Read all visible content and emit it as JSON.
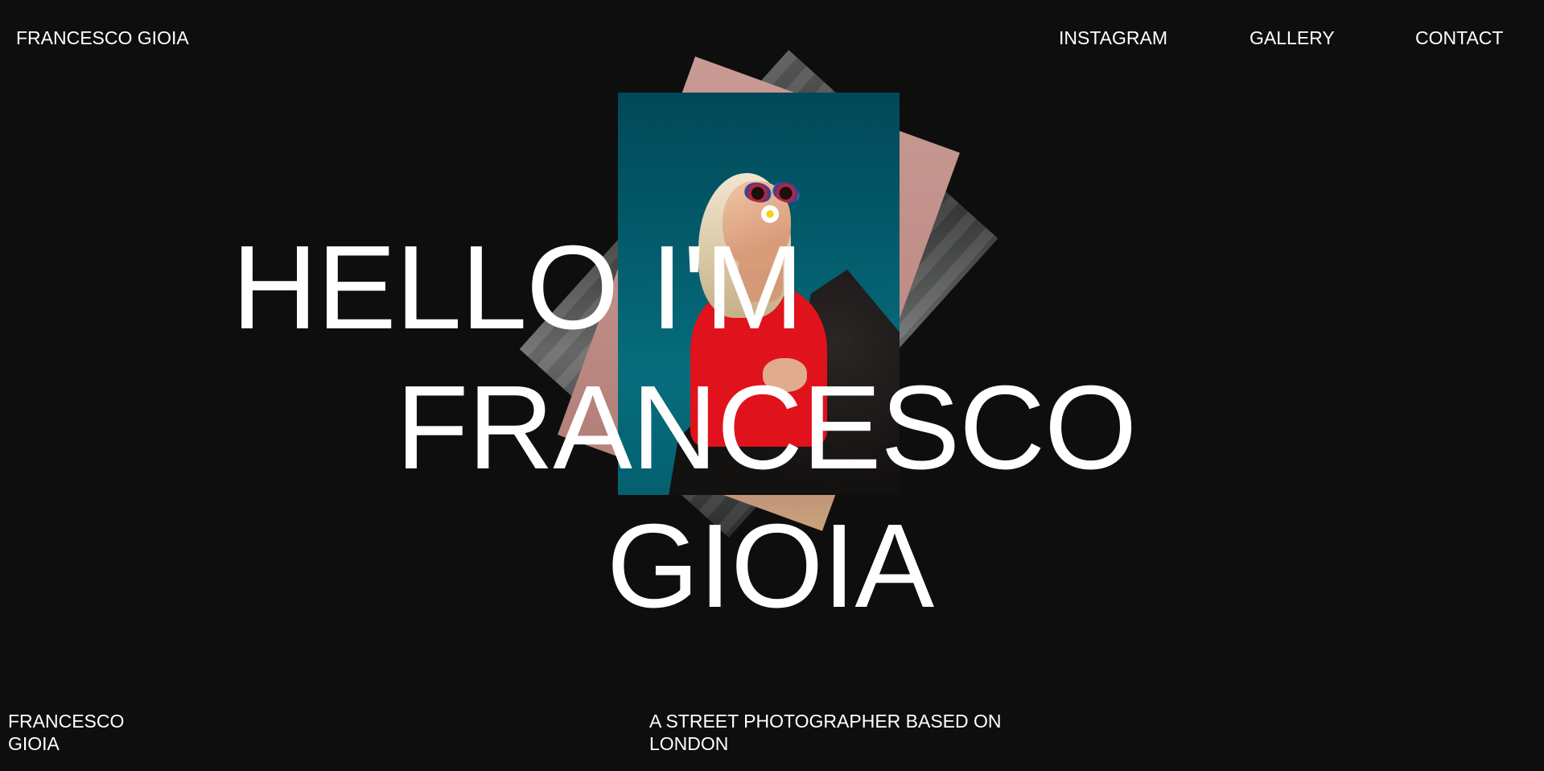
{
  "header": {
    "brand": "FRANCESCO GIOIA",
    "nav": {
      "instagram": "INSTAGRAM",
      "gallery": "GALLERY",
      "contact": "CONTACT"
    }
  },
  "hero": {
    "line1": "HELLO I'M",
    "line2": "FRANCESCO",
    "line3": "GIOIA"
  },
  "footer": {
    "name_line1": "FRANCESCO",
    "name_line2": "GIOIA",
    "tagline_line1": "A STREET PHOTOGRAPHER BASED ON",
    "tagline_line2": "LONDON"
  },
  "colors": {
    "background": "#0e0e0e",
    "text": "#ffffff",
    "photo_teal": "#035a6a",
    "photo_pink": "#c08d88",
    "photo_gray": "#4a4c4b"
  }
}
